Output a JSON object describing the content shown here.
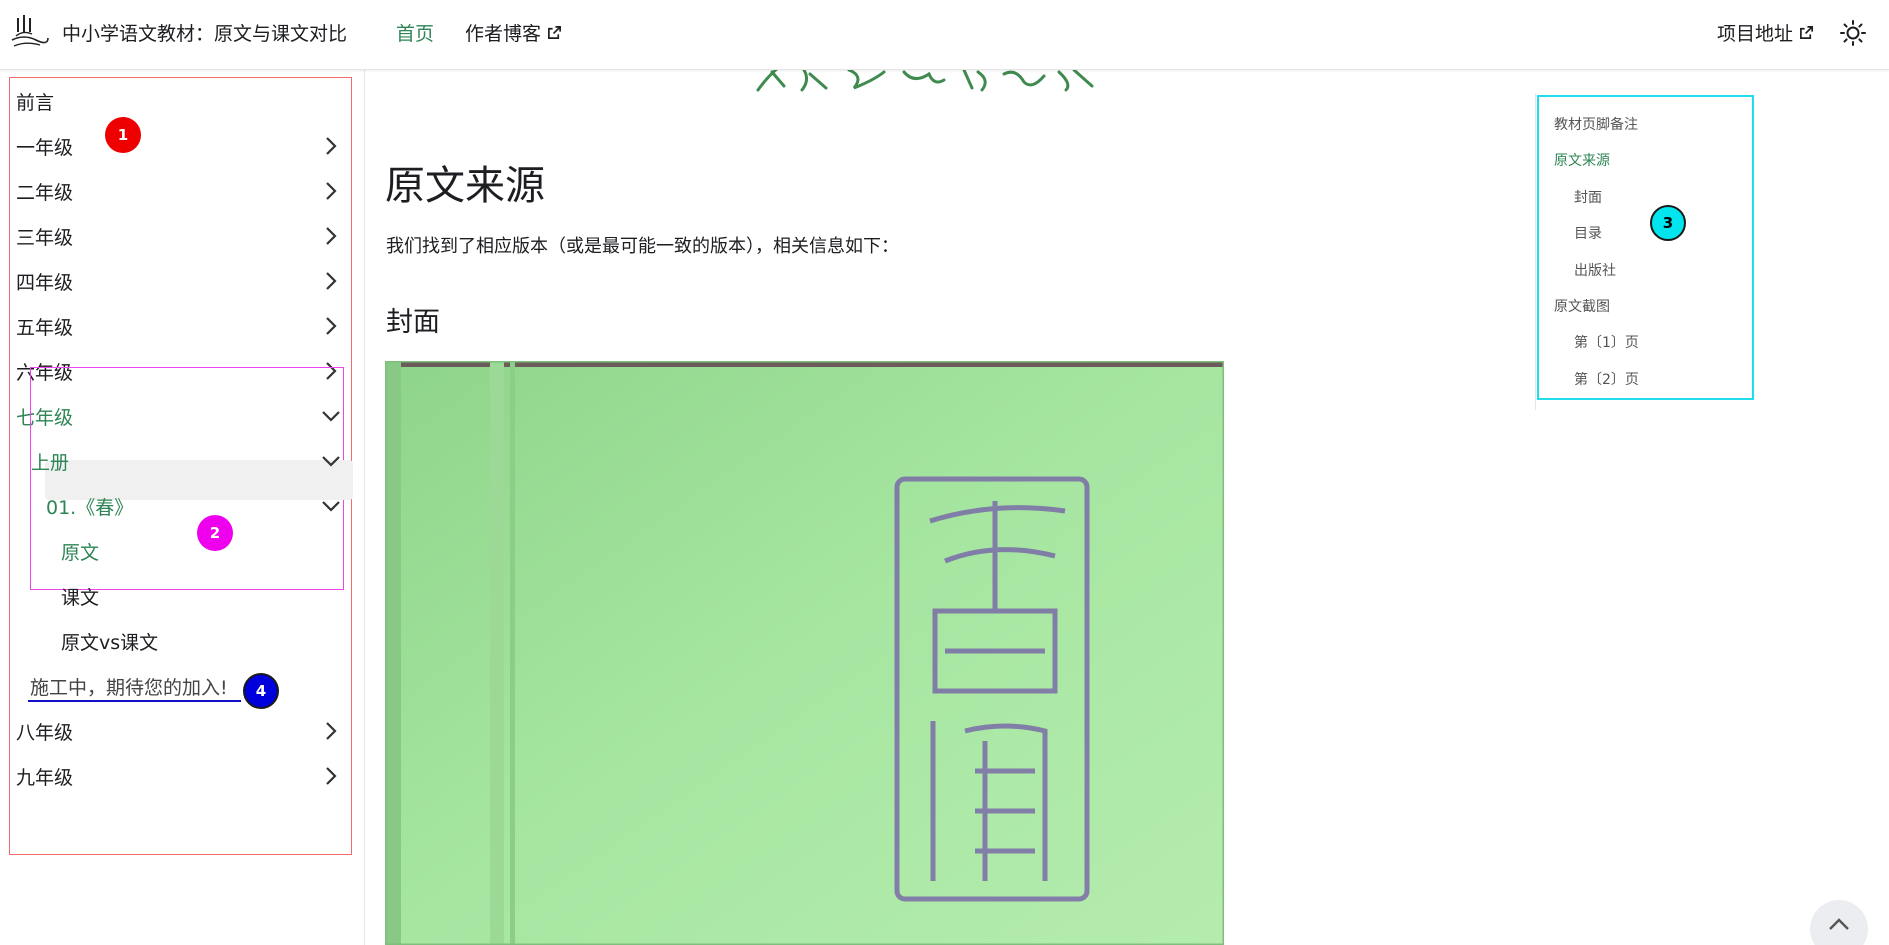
{
  "navbar": {
    "logo_icon": "reed-logo-icon",
    "site_title": "中小学语文教材：原文与课文对比",
    "links": [
      {
        "label": "首页",
        "active": true
      },
      {
        "label": "作者博客",
        "external": true
      }
    ],
    "project_link": "项目地址",
    "theme_icon": "sun-icon"
  },
  "sidebar": {
    "items": [
      {
        "label": "前言"
      },
      {
        "label": "一年级",
        "icon": "chevron-right-icon"
      },
      {
        "label": "二年级",
        "icon": "chevron-right-icon"
      },
      {
        "label": "三年级",
        "icon": "chevron-right-icon"
      },
      {
        "label": "四年级",
        "icon": "chevron-right-icon"
      },
      {
        "label": "五年级",
        "icon": "chevron-right-icon"
      },
      {
        "label": "六年级",
        "icon": "chevron-right-icon"
      },
      {
        "label": "七年级",
        "icon": "chevron-down-icon",
        "expanded": true
      },
      {
        "label": "八年级",
        "icon": "chevron-right-icon"
      },
      {
        "label": "九年级",
        "icon": "chevron-right-icon"
      }
    ],
    "grade7": {
      "volume": "上册",
      "lesson": "01.《春》",
      "pages": [
        {
          "label": "原文",
          "active": true
        },
        {
          "label": "课文"
        },
        {
          "label": "原文vs课文"
        }
      ],
      "wip": "施工中，期待您的加入!"
    }
  },
  "badges": [
    "1",
    "2",
    "3",
    "4"
  ],
  "main": {
    "heading": "原文来源",
    "intro": "我们找到了相应版本（或是最可能一致的版本），相关信息如下：",
    "section": "封面"
  },
  "toc": {
    "items": [
      {
        "label": "教材页脚备注"
      },
      {
        "label": "原文来源",
        "active": true
      },
      {
        "label": "封面"
      },
      {
        "label": "目录"
      },
      {
        "label": "出版社"
      },
      {
        "label": "原文截图"
      },
      {
        "label": "第〔1〕页"
      },
      {
        "label": "第〔2〕页"
      }
    ]
  },
  "colors": {
    "accent": "#2e8555",
    "cover_green": "#9ee39a",
    "seal": "#7a6ca8"
  }
}
